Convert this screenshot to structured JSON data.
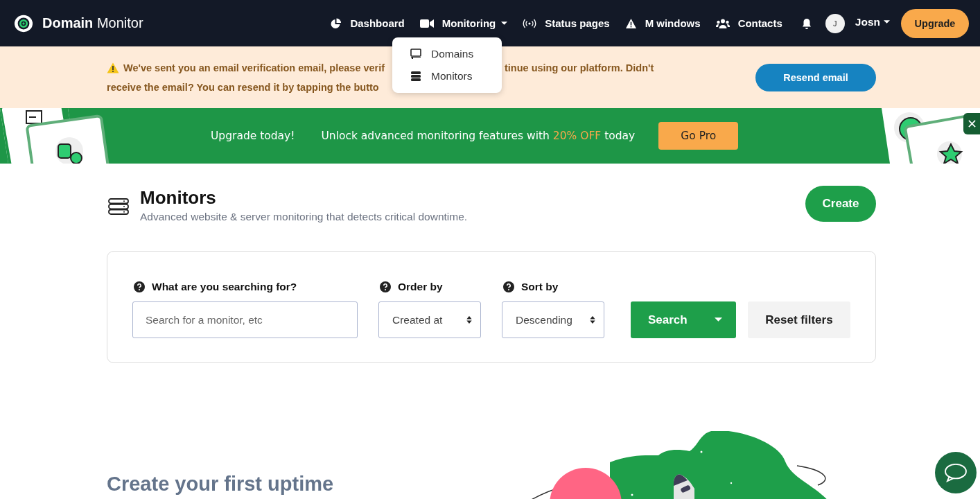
{
  "nav": {
    "brand": {
      "bold": "Domain",
      "light": "Monitor"
    },
    "items": [
      {
        "label": "Dashboard"
      },
      {
        "label": "Monitoring",
        "expanded": true,
        "menu": [
          "Domains",
          "Monitors"
        ]
      },
      {
        "label": "Status pages"
      },
      {
        "label": "M windows"
      },
      {
        "label": "Contacts"
      }
    ],
    "user": {
      "initial": "J",
      "name": "Josn"
    },
    "upgrade": "Upgrade"
  },
  "alert": {
    "line1_start": "We've sent you an email verification email, please verif",
    "line1_end": "tinue using our platform. Didn't",
    "line2": "receive the email? You can resend it by tapping the butto",
    "button": "Resend email"
  },
  "promo": {
    "title": "Upgrade today!",
    "text": "Unlock advanced monitoring features with **20% OFF** today",
    "button": "Go Pro"
  },
  "header": {
    "title": "Monitors",
    "subtitle": "Advanced website & server monitoring that detects critical downtime.",
    "button": "Create"
  },
  "filters": {
    "search": {
      "label": "What are you searching for?",
      "placeholder": "Search for a monitor, etc"
    },
    "order": {
      "label": "Order by",
      "value": "Created at"
    },
    "sort": {
      "label": "Sort by",
      "value": "Descending"
    },
    "search_button": "Search",
    "reset_button": "Reset filters"
  },
  "empty": {
    "title": "Create your first uptime"
  }
}
